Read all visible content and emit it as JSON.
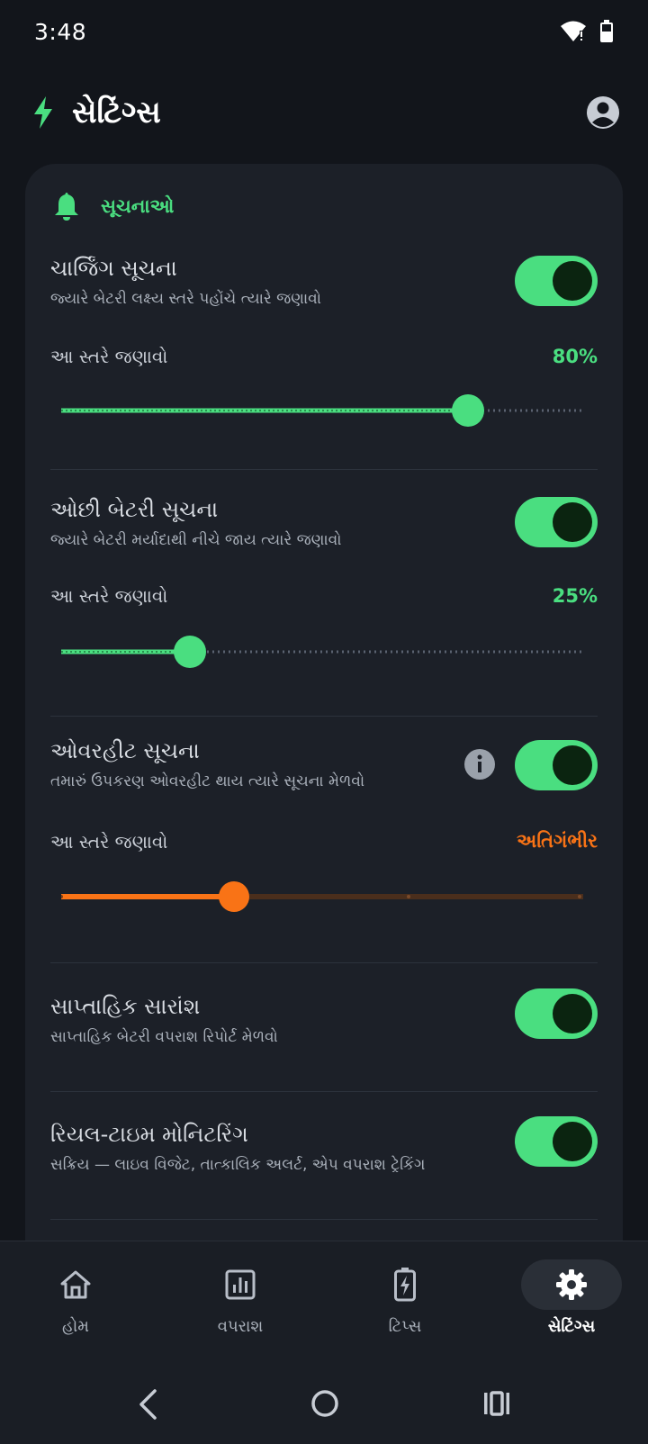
{
  "status_bar": {
    "time": "3:48"
  },
  "header": {
    "title": "સેટિંગ્સ",
    "bolt_icon": "bolt-icon",
    "avatar_icon": "account-circle-icon"
  },
  "colors": {
    "accent": "#4ade80",
    "warning": "#f97316",
    "card": "#1c2028",
    "background": "#12151b"
  },
  "notifications_section": {
    "title": "સૂચનાઓ",
    "icon": "bell-icon",
    "charging": {
      "title": "ચાર્જિંગ સૂચના",
      "subtitle": "જ્યારે બેટરી લક્ષ્ય સ્તરે પહોંચે ત્યારે જણાવો",
      "enabled": true,
      "level_label": "આ સ્તરે જણાવો",
      "level_value": "80%",
      "level": 80
    },
    "low_battery": {
      "title": "ઓછી બેટરી સૂચના",
      "subtitle": "જ્યારે બેટરી મર્યાદાથી નીચે જાય ત્યારે જણાવો",
      "enabled": true,
      "level_label": "આ સ્તરે જણાવો",
      "level_value": "25%",
      "level": 25
    },
    "overheat": {
      "title": "ઓવરહીટ સૂચના",
      "subtitle": "તમારું ઉપકરણ ઓવરહીટ થાય ત્યારે સૂચના મેળવો",
      "enabled": true,
      "info_icon": "info-icon",
      "level_label": "આ સ્તરે જણાવો",
      "level_value": "અતિગંભીર",
      "level_fraction": 0.33
    },
    "weekly_summary": {
      "title": "સાપ્તાહિક સારાંશ",
      "subtitle": "સાપ્તાહિક બેટરી વપરાશ રિપોર્ટ મેળવો",
      "enabled": true
    },
    "realtime": {
      "title": "રિયલ-ટાઇમ મોનિટરિંગ",
      "subtitle": "સક્રિય — લાઇવ વિજેટ, તાત્કાલિક અલર્ટ, એપ વપરાશ ટ્રેકિંગ",
      "enabled": true
    }
  },
  "bottom_nav": {
    "items": [
      {
        "label": "હોમ",
        "icon": "home-icon",
        "active": false
      },
      {
        "label": "વપરાશ",
        "icon": "usage-chart-icon",
        "active": false
      },
      {
        "label": "ટિપ્સ",
        "icon": "battery-tips-icon",
        "active": false
      },
      {
        "label": "સેટિંગ્સ",
        "icon": "gear-icon",
        "active": true
      }
    ]
  },
  "system_nav": {
    "back_icon": "back-icon",
    "home_icon": "home-circle-icon",
    "recents_icon": "recents-icon"
  }
}
